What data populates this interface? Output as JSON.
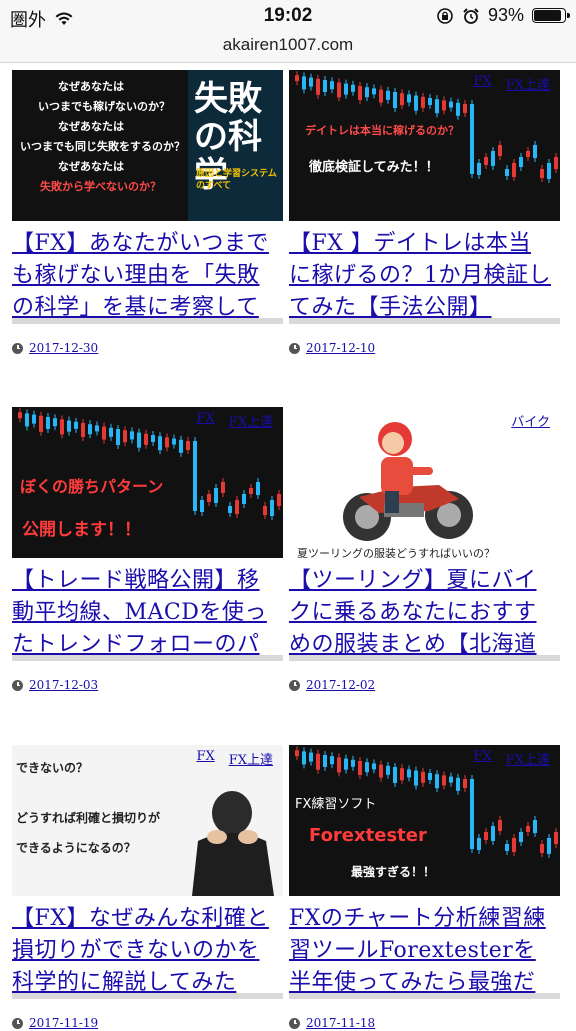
{
  "status": {
    "carrier": "圏外",
    "time": "19:02",
    "battery": "93%",
    "battery_level": 0.93
  },
  "browser": {
    "url": "akairen1007.com"
  },
  "cards": [
    {
      "title": "【FX】あなたがいつまでも稼げない理由を「失敗の科学」を基に考察して",
      "date": "2017-12-30",
      "tags": [],
      "thumb": {
        "lines": [
          "なぜあなたは",
          "いつまでも稼げないのか？",
          "なぜあなたは",
          "いつまでも同じ失敗をするのか？",
          "なぜあなたは",
          "失敗から学べないのか？"
        ],
        "book_title": "失敗の科学",
        "book_sub": "原因と学習システムのすべて"
      }
    },
    {
      "title": "【FX 】デイトレは本当に稼げるの？1か月検証してみた【手法公開】",
      "date": "2017-12-10",
      "tags": [
        "FX",
        "FX上達"
      ],
      "thumb": {
        "lines": [
          "デイトレは本当に稼げるのか？",
          "徹底検証してみた！！"
        ]
      }
    },
    {
      "title": "【トレード戦略公開】移動平均線、MACDを使ったトレンドフォローのパ",
      "date": "2017-12-03",
      "tags": [
        "FX",
        "FX上達"
      ],
      "thumb": {
        "lines": [
          "ぼくの勝ちパターン",
          "公開します！！"
        ]
      }
    },
    {
      "title": "【ツーリング】夏にバイクに乗るあなたにおすすめの服装まとめ【北海道",
      "date": "2017-12-02",
      "tags": [
        "バイク"
      ],
      "thumb": {
        "lines": [
          "夏ツーリングの服装どうすればいいの？"
        ]
      }
    },
    {
      "title": "【FX】なぜみんな利確と損切りができないのかを科学的に解説してみた",
      "date": "2017-11-19",
      "tags": [
        "FX",
        "FX上達"
      ],
      "thumb": {
        "lines": [
          "できないの？",
          "どうすれば利確と損切りが",
          "できるようになるの？"
        ]
      }
    },
    {
      "title": "FXのチャート分析練習練習ツールForextesterを半年使ってみたら最強だっ",
      "date": "2017-11-18",
      "tags": [
        "FX",
        "FX上達"
      ],
      "thumb": {
        "lines": [
          "FX練習ソフト",
          "Forextester",
          "最強すぎる！！"
        ]
      }
    }
  ]
}
